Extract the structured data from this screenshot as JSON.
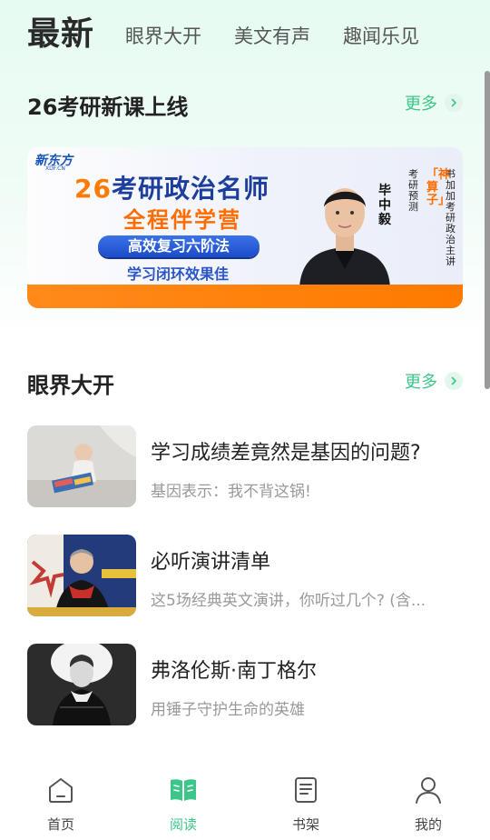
{
  "tabs": {
    "active": "最新",
    "items": [
      "眼界大开",
      "美文有声",
      "趣闻乐见"
    ]
  },
  "sections": {
    "kaoyan": {
      "title": "26考研新课上线",
      "more": "更多"
    },
    "yanjie": {
      "title": "眼界大开",
      "more": "更多"
    }
  },
  "banner": {
    "logo": "新东方",
    "logo_sub": "XDF.CN",
    "headline_num": "26",
    "headline_rest": "考研政治名师",
    "subhead": "全程伴学营",
    "pill": "高效复习六阶法",
    "tagline": "学习闭环效果佳",
    "name": "毕中毅",
    "vertical_1": "考研预测",
    "vertical_2": "「神算子」",
    "vertical_3": "书加加考研政治主讲"
  },
  "articles": [
    {
      "title": "学习成绩差竟然是基因的问题?",
      "subtitle": "基因表示：我不背这锅!",
      "thumb": "baby-reading-photo"
    },
    {
      "title": "必听演讲清单",
      "subtitle": "这5场经典英文演讲，你听过几个? (含...",
      "thumb": "speaker-photo"
    },
    {
      "title": "弗洛伦斯·南丁格尔",
      "subtitle": "用锤子守护生命的英雄",
      "thumb": "portrait-photo"
    }
  ],
  "bottom_nav": [
    {
      "label": "首页",
      "icon": "home-icon",
      "active": false
    },
    {
      "label": "阅读",
      "icon": "book-open-icon",
      "active": true
    },
    {
      "label": "书架",
      "icon": "bookshelf-icon",
      "active": false
    },
    {
      "label": "我的",
      "icon": "user-icon",
      "active": false
    }
  ],
  "colors": {
    "accent": "#3cc68a",
    "banner_orange": "#ff7a00",
    "banner_blue": "#1d3e9c"
  }
}
